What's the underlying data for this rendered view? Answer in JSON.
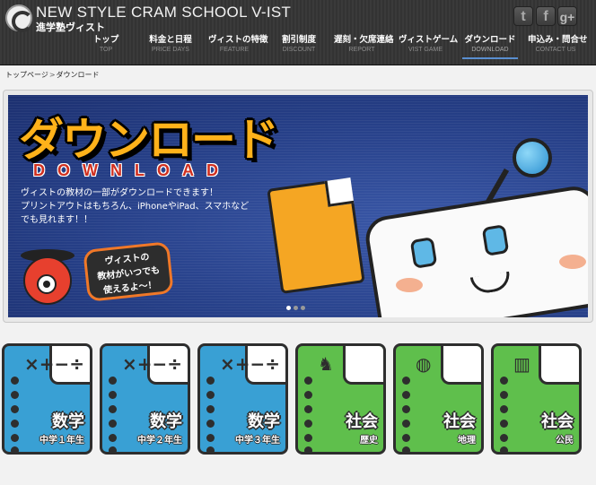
{
  "header": {
    "logo_title": "NEW STYLE CRAM SCHOOL V-IST",
    "logo_sub": "進学塾ヴィスト",
    "social": [
      {
        "name": "twitter-icon",
        "glyph": "t"
      },
      {
        "name": "facebook-icon",
        "glyph": "f"
      },
      {
        "name": "googleplus-icon",
        "glyph": "g+"
      }
    ]
  },
  "nav": [
    {
      "jp": "トップ",
      "en": "TOP"
    },
    {
      "jp": "料金と日程",
      "en": "PRICE DAYS"
    },
    {
      "jp": "ヴィストの特徴",
      "en": "FEATURE"
    },
    {
      "jp": "割引制度",
      "en": "DISCOUNT"
    },
    {
      "jp": "遅刻・欠席連絡",
      "en": "REPORT"
    },
    {
      "jp": "ヴィストゲーム",
      "en": "VIST GAME"
    },
    {
      "jp": "ダウンロード",
      "en": "DOWNLOAD"
    },
    {
      "jp": "申込み・問合せ",
      "en": "CONTACT US"
    }
  ],
  "breadcrumb": {
    "home": "トップページ",
    "sep": ">",
    "current": "ダウンロード"
  },
  "hero": {
    "title": "ダウンロード",
    "subtitle": "DOWNLOAD",
    "text_line1": "ヴィストの教材の一部がダウンロードできます！",
    "text_line2": "プリントアウトはもちろん、iPhoneやiPad、スマホなどでも見れます！！",
    "bubble_line1": "ヴィストの",
    "bubble_line2": "教材がいつでも",
    "bubble_line3": "使えるよ～！"
  },
  "cards": [
    {
      "subject": "数学",
      "grade": "中学１年生",
      "kind": "math",
      "glyph": "×+−÷"
    },
    {
      "subject": "数学",
      "grade": "中学２年生",
      "kind": "math",
      "glyph": "×+−÷"
    },
    {
      "subject": "数学",
      "grade": "中学３年生",
      "kind": "math",
      "glyph": "×+−÷"
    },
    {
      "subject": "社会",
      "grade": "歴史",
      "kind": "soc",
      "glyph": "♞"
    },
    {
      "subject": "社会",
      "grade": "地理",
      "kind": "soc",
      "glyph": "◍"
    },
    {
      "subject": "社会",
      "grade": "公民",
      "kind": "soc",
      "glyph": "▥"
    }
  ],
  "colors": {
    "math_card": "#39a0d4",
    "social_card": "#5fbf4c",
    "hero_title": "#ffb21a",
    "header_bg": "#363636",
    "active_underline": "#5a8fd0"
  }
}
